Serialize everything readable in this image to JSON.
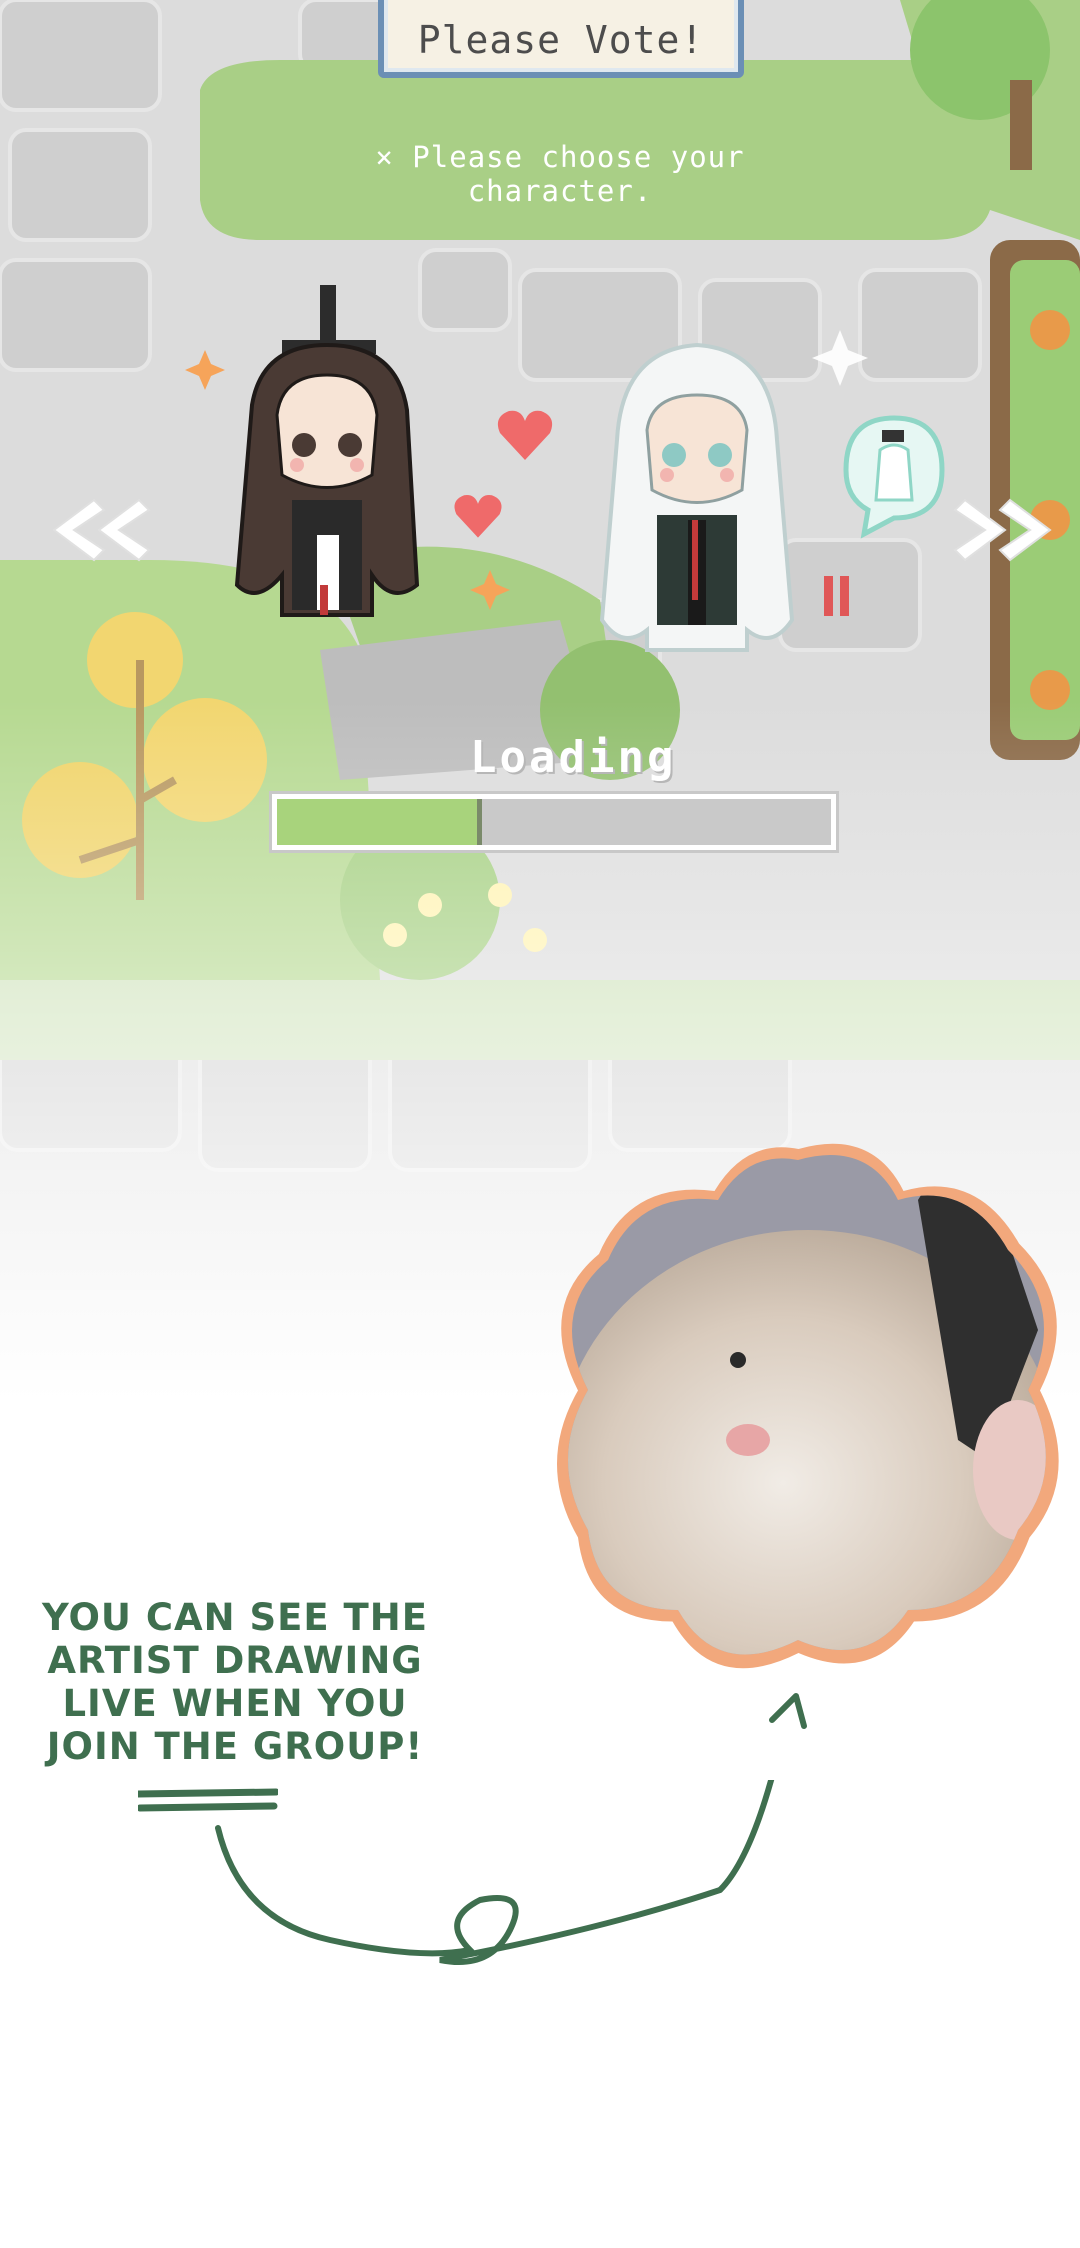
{
  "vote_button": {
    "label": "Please Vote!"
  },
  "prompt": {
    "text": "× Please choose your character."
  },
  "loading": {
    "text": "Loading ...",
    "progress": 0.37
  },
  "navigation": {
    "left_icon": "double-chevron-left-icon",
    "right_icon": "double-chevron-right-icon"
  },
  "characters": [
    {
      "name_icon": "dark-haired-character-sprite"
    },
    {
      "name_icon": "white-haired-character-sprite"
    }
  ],
  "caption": {
    "lines": [
      "YOU CAN SEE THE",
      "ARTIST DRAWING",
      "LIVE WHEN YOU",
      "JOIN THE GROUP!"
    ]
  },
  "colors": {
    "caption_green": "#3f6f4f",
    "frame_orange": "#f2a87c",
    "progress_green": "#a8d37c",
    "grass": "#a9cf86",
    "stone": "#d9d9d9"
  }
}
